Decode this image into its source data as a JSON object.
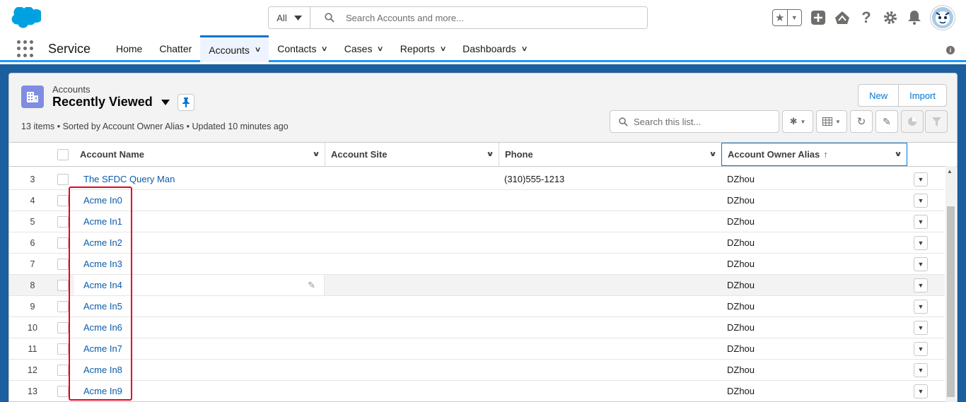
{
  "header": {
    "search_scope": "All",
    "search_placeholder": "Search Accounts and more..."
  },
  "nav": {
    "app_name": "Service",
    "items": [
      {
        "label": "Home",
        "has_menu": false
      },
      {
        "label": "Chatter",
        "has_menu": false
      },
      {
        "label": "Accounts",
        "has_menu": true,
        "active": true
      },
      {
        "label": "Contacts",
        "has_menu": true
      },
      {
        "label": "Cases",
        "has_menu": true
      },
      {
        "label": "Reports",
        "has_menu": true
      },
      {
        "label": "Dashboards",
        "has_menu": true
      }
    ]
  },
  "list_view": {
    "object_label": "Accounts",
    "view_name": "Recently Viewed",
    "meta": "13 items • Sorted by Account Owner Alias • Updated 10 minutes ago",
    "search_placeholder": "Search this list...",
    "buttons": {
      "new": "New",
      "import": "Import"
    }
  },
  "table": {
    "columns": [
      "Account Name",
      "Account Site",
      "Phone",
      "Account Owner Alias"
    ],
    "sorted_column": "Account Owner Alias",
    "rows": [
      {
        "num": "3",
        "name": "The SFDC Query Man",
        "site": "",
        "phone": "(310)555-1213",
        "owner": "DZhou"
      },
      {
        "num": "4",
        "name": "Acme In0",
        "site": "",
        "phone": "",
        "owner": "DZhou"
      },
      {
        "num": "5",
        "name": "Acme In1",
        "site": "",
        "phone": "",
        "owner": "DZhou"
      },
      {
        "num": "6",
        "name": "Acme In2",
        "site": "",
        "phone": "",
        "owner": "DZhou"
      },
      {
        "num": "7",
        "name": "Acme In3",
        "site": "",
        "phone": "",
        "owner": "DZhou"
      },
      {
        "num": "8",
        "name": "Acme In4",
        "site": "",
        "phone": "",
        "owner": "DZhou",
        "hovered": true
      },
      {
        "num": "9",
        "name": "Acme In5",
        "site": "",
        "phone": "",
        "owner": "DZhou"
      },
      {
        "num": "10",
        "name": "Acme In6",
        "site": "",
        "phone": "",
        "owner": "DZhou"
      },
      {
        "num": "11",
        "name": "Acme In7",
        "site": "",
        "phone": "",
        "owner": "DZhou"
      },
      {
        "num": "12",
        "name": "Acme In8",
        "site": "",
        "phone": "",
        "owner": "DZhou"
      },
      {
        "num": "13",
        "name": "Acme In9",
        "site": "",
        "phone": "",
        "owner": "DZhou"
      }
    ]
  },
  "colors": {
    "brand_blue": "#0176d3",
    "link": "#0b5cab",
    "highlight_box": "#ea001e",
    "object_icon": "#7f8de1"
  }
}
